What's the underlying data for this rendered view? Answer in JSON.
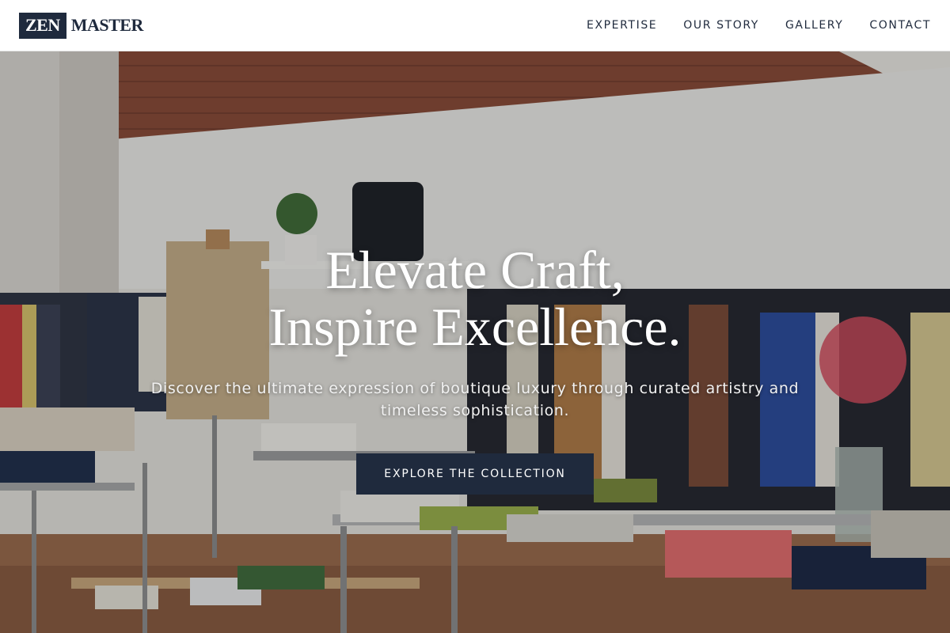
{
  "brand": {
    "logo_box": "ZEN",
    "logo_text": "MASTER"
  },
  "nav": {
    "items": [
      {
        "label": "EXPERTISE"
      },
      {
        "label": "OUR STORY"
      },
      {
        "label": "GALLERY"
      },
      {
        "label": "CONTACT"
      }
    ]
  },
  "hero": {
    "title_line1": "Elevate Craft,",
    "title_line2": "Inspire Excellence.",
    "subtitle": "Discover the ultimate expression of boutique luxury through curated artistry and timeless sophistication.",
    "cta_label": "EXPLORE THE COLLECTION",
    "image_alt": "Boutique clothing store interior"
  },
  "colors": {
    "brand_navy": "#1f2a3d",
    "header_bg": "#ffffff",
    "hero_text": "#ffffff"
  }
}
